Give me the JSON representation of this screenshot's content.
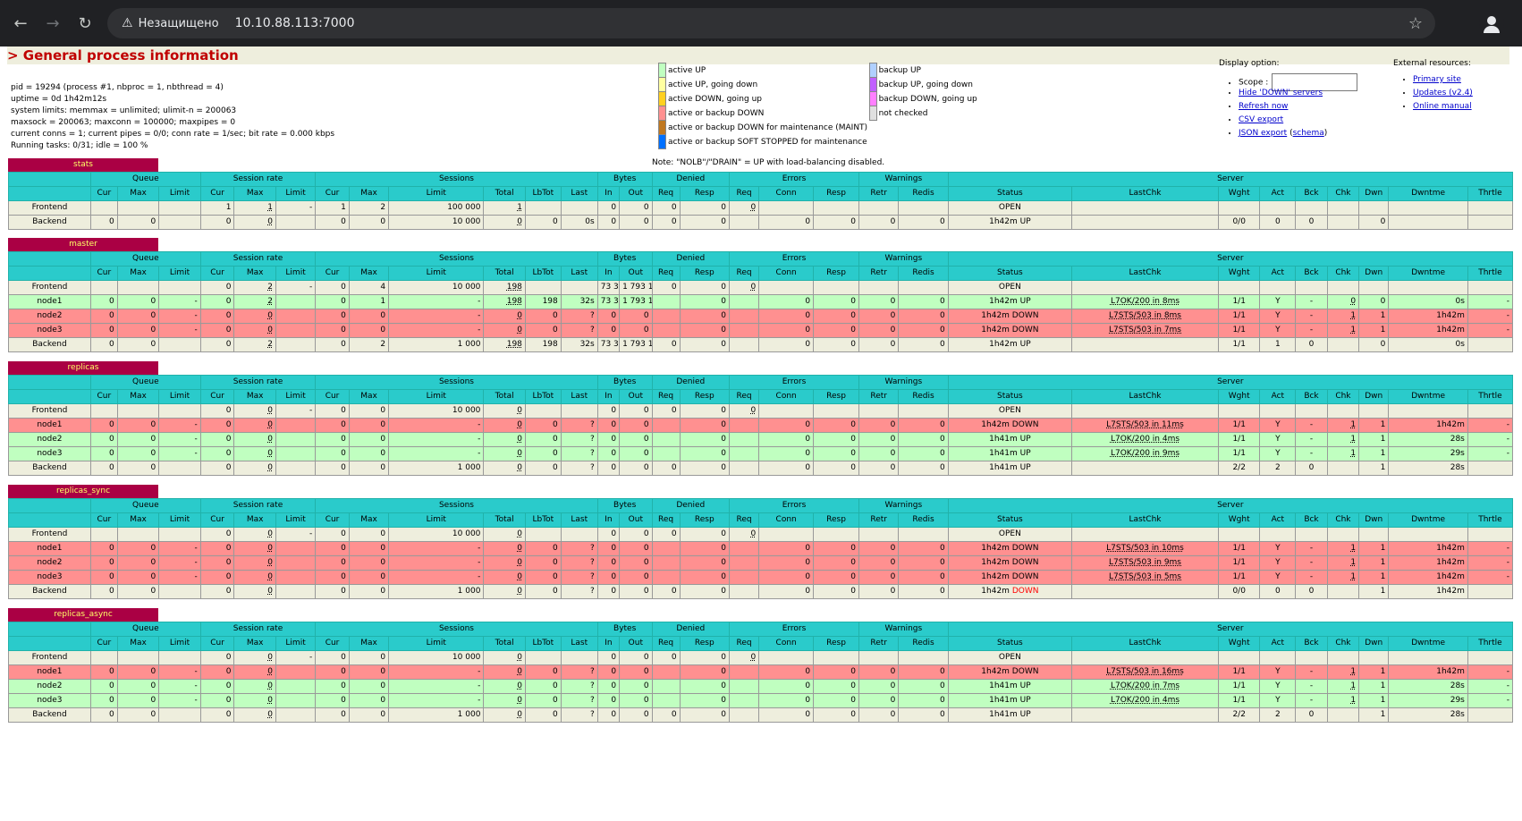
{
  "browser": {
    "security_label": "Незащищено",
    "url": "10.10.88.113:7000"
  },
  "page": {
    "section_title": "> General process information",
    "process_info": [
      "pid = 19294 (process #1, nbproc = 1, nbthread = 4)",
      "uptime = 0d 1h42m12s",
      "system limits: memmax = unlimited; ulimit-n = 200063",
      "maxsock = 200063; maxconn = 100000; maxpipes = 0",
      "current conns = 1; current pipes = 0/0; conn rate = 1/sec; bit rate = 0.000 kbps",
      "Running tasks: 0/31; idle = 100 %"
    ],
    "legend_left": [
      {
        "label": "active UP",
        "color": "#c0ffc0"
      },
      {
        "label": "active UP, going down",
        "color": "#ffffa0"
      },
      {
        "label": "active DOWN, going up",
        "color": "#ffd020"
      },
      {
        "label": "active or backup DOWN",
        "color": "#ff9090"
      },
      {
        "label": "active or backup DOWN for maintenance (MAINT)",
        "color": "#c07820"
      },
      {
        "label": "active or backup SOFT STOPPED for maintenance",
        "color": "#0070ff"
      }
    ],
    "legend_right": [
      {
        "label": "backup UP",
        "color": "#b0d0ff"
      },
      {
        "label": "backup UP, going down",
        "color": "#c060ff"
      },
      {
        "label": "backup DOWN, going up",
        "color": "#ff80ff"
      },
      {
        "label": "not checked",
        "color": "#e0e0e0"
      }
    ],
    "legend_note": "Note: \"NOLB\"/\"DRAIN\" = UP with load-balancing disabled.",
    "display_options": {
      "title": "Display option:",
      "scope_label": "Scope :",
      "links": [
        "Hide 'DOWN' servers",
        "Refresh now",
        "CSV export",
        "JSON export"
      ],
      "schema_link": "schema"
    },
    "external_resources": {
      "title": "External resources:",
      "links": [
        "Primary site",
        "Updates (v2.4)",
        "Online manual"
      ]
    }
  },
  "table_headers": {
    "groups": [
      "Queue",
      "Session rate",
      "Sessions",
      "Bytes",
      "Denied",
      "Errors",
      "Warnings",
      "Server"
    ],
    "cols": [
      "Cur",
      "Max",
      "Limit",
      "Cur",
      "Max",
      "Limit",
      "Cur",
      "Max",
      "Limit",
      "Total",
      "LbTot",
      "Last",
      "In",
      "Out",
      "Req",
      "Resp",
      "Req",
      "Conn",
      "Resp",
      "Retr",
      "Redis",
      "Status",
      "LastChk",
      "Wght",
      "Act",
      "Bck",
      "Chk",
      "Dwn",
      "Dwntme",
      "Thrtle"
    ]
  },
  "proxies": [
    {
      "name": "stats",
      "rows": [
        {
          "type": "frontend",
          "cells": [
            "Frontend",
            "",
            "",
            "",
            "1",
            "1",
            "-",
            "1",
            "2",
            "100 000",
            "1",
            "",
            "",
            "0",
            "0",
            "0",
            "0",
            "0",
            "",
            "",
            "",
            "",
            "OPEN",
            "",
            "",
            "",
            "",
            "",
            "",
            "",
            ""
          ]
        },
        {
          "type": "backend",
          "cells": [
            "Backend",
            "0",
            "0",
            "",
            "0",
            "0",
            "",
            "0",
            "0",
            "10 000",
            "0",
            "0",
            "0s",
            "0",
            "0",
            "0",
            "0",
            "",
            "0",
            "0",
            "0",
            "0",
            "1h42m UP",
            "",
            "0/0",
            "0",
            "0",
            "",
            "0",
            "",
            ""
          ]
        }
      ]
    },
    {
      "name": "master",
      "rows": [
        {
          "type": "frontend",
          "cells": [
            "Frontend",
            "",
            "",
            "",
            "0",
            "2",
            "-",
            "0",
            "4",
            "10 000",
            "198",
            "",
            "",
            "73 339",
            "1 793 106",
            "0",
            "0",
            "0",
            "",
            "",
            "",
            "",
            "OPEN",
            "",
            "",
            "",
            "",
            "",
            "",
            "",
            ""
          ]
        },
        {
          "type": "up",
          "cells": [
            "node1",
            "0",
            "0",
            "-",
            "0",
            "2",
            "",
            "0",
            "1",
            "-",
            "198",
            "198",
            "32s",
            "73 339",
            "1 793 106",
            "",
            "0",
            "",
            "0",
            "0",
            "0",
            "0",
            "1h42m UP",
            "L7OK/200 in 8ms",
            "1/1",
            "Y",
            "-",
            "0",
            "0",
            "0s",
            "-"
          ]
        },
        {
          "type": "down",
          "cells": [
            "node2",
            "0",
            "0",
            "-",
            "0",
            "0",
            "",
            "0",
            "0",
            "-",
            "0",
            "0",
            "?",
            "0",
            "0",
            "",
            "0",
            "",
            "0",
            "0",
            "0",
            "0",
            "1h42m DOWN",
            "L7STS/503 in 8ms",
            "1/1",
            "Y",
            "-",
            "1",
            "1",
            "1h42m",
            "-"
          ]
        },
        {
          "type": "down",
          "cells": [
            "node3",
            "0",
            "0",
            "-",
            "0",
            "0",
            "",
            "0",
            "0",
            "-",
            "0",
            "0",
            "?",
            "0",
            "0",
            "",
            "0",
            "",
            "0",
            "0",
            "0",
            "0",
            "1h42m DOWN",
            "L7STS/503 in 7ms",
            "1/1",
            "Y",
            "-",
            "1",
            "1",
            "1h42m",
            "-"
          ]
        },
        {
          "type": "backend",
          "cells": [
            "Backend",
            "0",
            "0",
            "",
            "0",
            "2",
            "",
            "0",
            "2",
            "1 000",
            "198",
            "198",
            "32s",
            "73 339",
            "1 793 106",
            "0",
            "0",
            "",
            "0",
            "0",
            "0",
            "0",
            "1h42m UP",
            "",
            "1/1",
            "1",
            "0",
            "",
            "0",
            "0s",
            ""
          ]
        }
      ]
    },
    {
      "name": "replicas",
      "rows": [
        {
          "type": "frontend",
          "cells": [
            "Frontend",
            "",
            "",
            "",
            "0",
            "0",
            "-",
            "0",
            "0",
            "10 000",
            "0",
            "",
            "",
            "0",
            "0",
            "0",
            "0",
            "0",
            "",
            "",
            "",
            "",
            "OPEN",
            "",
            "",
            "",
            "",
            "",
            "",
            "",
            ""
          ]
        },
        {
          "type": "down",
          "cells": [
            "node1",
            "0",
            "0",
            "-",
            "0",
            "0",
            "",
            "0",
            "0",
            "-",
            "0",
            "0",
            "?",
            "0",
            "0",
            "",
            "0",
            "",
            "0",
            "0",
            "0",
            "0",
            "1h42m DOWN",
            "L7STS/503 in 11ms",
            "1/1",
            "Y",
            "-",
            "1",
            "1",
            "1h42m",
            "-"
          ]
        },
        {
          "type": "up",
          "cells": [
            "node2",
            "0",
            "0",
            "-",
            "0",
            "0",
            "",
            "0",
            "0",
            "-",
            "0",
            "0",
            "?",
            "0",
            "0",
            "",
            "0",
            "",
            "0",
            "0",
            "0",
            "0",
            "1h41m UP",
            "L7OK/200 in 4ms",
            "1/1",
            "Y",
            "-",
            "1",
            "1",
            "28s",
            "-"
          ]
        },
        {
          "type": "up",
          "cells": [
            "node3",
            "0",
            "0",
            "-",
            "0",
            "0",
            "",
            "0",
            "0",
            "-",
            "0",
            "0",
            "?",
            "0",
            "0",
            "",
            "0",
            "",
            "0",
            "0",
            "0",
            "0",
            "1h41m UP",
            "L7OK/200 in 9ms",
            "1/1",
            "Y",
            "-",
            "1",
            "1",
            "29s",
            "-"
          ]
        },
        {
          "type": "backend",
          "cells": [
            "Backend",
            "0",
            "0",
            "",
            "0",
            "0",
            "",
            "0",
            "0",
            "1 000",
            "0",
            "0",
            "?",
            "0",
            "0",
            "0",
            "0",
            "",
            "0",
            "0",
            "0",
            "0",
            "1h41m UP",
            "",
            "2/2",
            "2",
            "0",
            "",
            "1",
            "28s",
            ""
          ]
        }
      ]
    },
    {
      "name": "replicas_sync",
      "rows": [
        {
          "type": "frontend",
          "cells": [
            "Frontend",
            "",
            "",
            "",
            "0",
            "0",
            "-",
            "0",
            "0",
            "10 000",
            "0",
            "",
            "",
            "0",
            "0",
            "0",
            "0",
            "0",
            "",
            "",
            "",
            "",
            "OPEN",
            "",
            "",
            "",
            "",
            "",
            "",
            "",
            ""
          ]
        },
        {
          "type": "down",
          "cells": [
            "node1",
            "0",
            "0",
            "-",
            "0",
            "0",
            "",
            "0",
            "0",
            "-",
            "0",
            "0",
            "?",
            "0",
            "0",
            "",
            "0",
            "",
            "0",
            "0",
            "0",
            "0",
            "1h42m DOWN",
            "L7STS/503 in 10ms",
            "1/1",
            "Y",
            "-",
            "1",
            "1",
            "1h42m",
            "-"
          ]
        },
        {
          "type": "down",
          "cells": [
            "node2",
            "0",
            "0",
            "-",
            "0",
            "0",
            "",
            "0",
            "0",
            "-",
            "0",
            "0",
            "?",
            "0",
            "0",
            "",
            "0",
            "",
            "0",
            "0",
            "0",
            "0",
            "1h42m DOWN",
            "L7STS/503 in 9ms",
            "1/1",
            "Y",
            "-",
            "1",
            "1",
            "1h42m",
            "-"
          ]
        },
        {
          "type": "down",
          "cells": [
            "node3",
            "0",
            "0",
            "-",
            "0",
            "0",
            "",
            "0",
            "0",
            "-",
            "0",
            "0",
            "?",
            "0",
            "0",
            "",
            "0",
            "",
            "0",
            "0",
            "0",
            "0",
            "1h42m DOWN",
            "L7STS/503 in 5ms",
            "1/1",
            "Y",
            "-",
            "1",
            "1",
            "1h42m",
            "-"
          ]
        },
        {
          "type": "backend",
          "cells": [
            "Backend",
            "0",
            "0",
            "",
            "0",
            "0",
            "",
            "0",
            "0",
            "1 000",
            "0",
            "0",
            "?",
            "0",
            "0",
            "0",
            "0",
            "",
            "0",
            "0",
            "0",
            "0",
            "1h42m DOWN",
            "",
            "0/0",
            "0",
            "0",
            "",
            "1",
            "1h42m",
            ""
          ]
        }
      ]
    },
    {
      "name": "replicas_async",
      "rows": [
        {
          "type": "frontend",
          "cells": [
            "Frontend",
            "",
            "",
            "",
            "0",
            "0",
            "-",
            "0",
            "0",
            "10 000",
            "0",
            "",
            "",
            "0",
            "0",
            "0",
            "0",
            "0",
            "",
            "",
            "",
            "",
            "OPEN",
            "",
            "",
            "",
            "",
            "",
            "",
            "",
            ""
          ]
        },
        {
          "type": "down",
          "cells": [
            "node1",
            "0",
            "0",
            "-",
            "0",
            "0",
            "",
            "0",
            "0",
            "-",
            "0",
            "0",
            "?",
            "0",
            "0",
            "",
            "0",
            "",
            "0",
            "0",
            "0",
            "0",
            "1h42m DOWN",
            "L7STS/503 in 16ms",
            "1/1",
            "Y",
            "-",
            "1",
            "1",
            "1h42m",
            "-"
          ]
        },
        {
          "type": "up",
          "cells": [
            "node2",
            "0",
            "0",
            "-",
            "0",
            "0",
            "",
            "0",
            "0",
            "-",
            "0",
            "0",
            "?",
            "0",
            "0",
            "",
            "0",
            "",
            "0",
            "0",
            "0",
            "0",
            "1h41m UP",
            "L7OK/200 in 7ms",
            "1/1",
            "Y",
            "-",
            "1",
            "1",
            "28s",
            "-"
          ]
        },
        {
          "type": "up",
          "cells": [
            "node3",
            "0",
            "0",
            "-",
            "0",
            "0",
            "",
            "0",
            "0",
            "-",
            "0",
            "0",
            "?",
            "0",
            "0",
            "",
            "0",
            "",
            "0",
            "0",
            "0",
            "0",
            "1h41m UP",
            "L7OK/200 in 4ms",
            "1/1",
            "Y",
            "-",
            "1",
            "1",
            "29s",
            "-"
          ]
        },
        {
          "type": "backend",
          "cells": [
            "Backend",
            "0",
            "0",
            "",
            "0",
            "0",
            "",
            "0",
            "0",
            "1 000",
            "0",
            "0",
            "?",
            "0",
            "0",
            "0",
            "0",
            "",
            "0",
            "0",
            "0",
            "0",
            "1h41m UP",
            "",
            "2/2",
            "2",
            "0",
            "",
            "1",
            "28s",
            ""
          ]
        }
      ]
    }
  ]
}
